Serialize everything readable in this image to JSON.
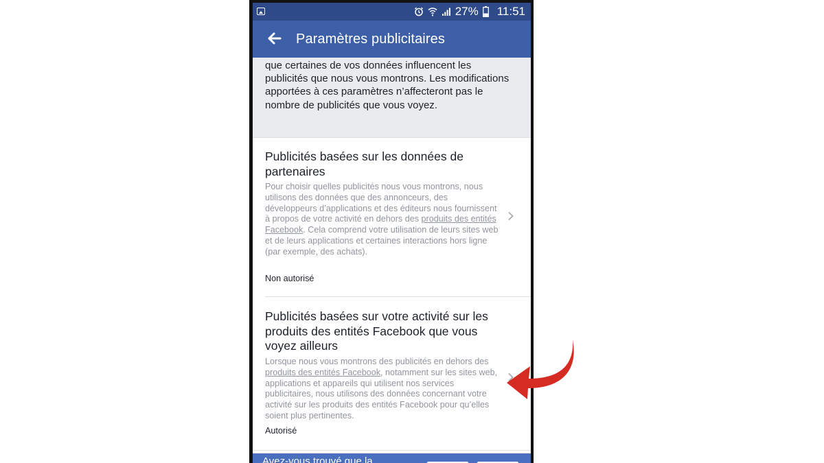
{
  "status_bar": {
    "battery": "27%",
    "time": "11:51",
    "icons": [
      "image-icon",
      "alarm-icon",
      "wifi-icon",
      "signal-icon",
      "battery-icon"
    ]
  },
  "app_bar": {
    "title": "Paramètres publicitaires",
    "back_icon": "back-arrow-icon"
  },
  "intro": {
    "text": "que certaines de vos données influencent les publicités que nous vous montrons. Les modifications apportées à ces paramètres n’affecteront pas le nombre de publicités que vous voyez."
  },
  "sections": [
    {
      "title": "Publicités basées sur les données de partenaires",
      "body_before_link": "Pour choisir quelles publicités nous vous montrons, nous utilisons des données que des annonceurs, des développeurs d’applications et des éditeurs nous fournissent à propos de votre activité en dehors des ",
      "link": "produits des entités Facebook",
      "body_after_link": ". Cela comprend votre utilisation de leurs sites web et de leurs applications et certaines interactions hors ligne (par exemple, des achats).",
      "status": "Non autorisé"
    },
    {
      "title": "Publicités basées sur votre activité sur les produits des entités Facebook que vous voyez ailleurs",
      "body_before_link": "Lorsque nous vous montrons des publicités en dehors des ",
      "link": "produits des entités Facebook",
      "body_after_link": ", notamment sur les sites web, applications et appareils qui utilisent nos services publicitaires, nous utilisons des données concernant votre activité sur les produits des entités Facebook pour qu’elles soient plus pertinentes.",
      "status": "Autorisé"
    }
  ],
  "survey_bar": {
    "text": "Avez-vous trouvé que la"
  },
  "colors": {
    "status_bar": "#2f4a88",
    "app_bar": "#3d5fa8",
    "intro_bg": "#e9ebee",
    "annotation_arrow": "#d62b22"
  }
}
